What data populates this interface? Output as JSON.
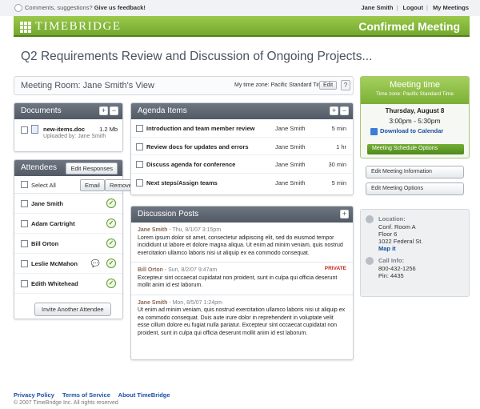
{
  "topbar": {
    "feedback_prefix": "Comments, suggestions?",
    "feedback_link": "Give us feedback!",
    "user": "Jane Smith",
    "logout": "Logout",
    "my_meetings": "My Meetings"
  },
  "header": {
    "logo": "TIMEBRIDGE",
    "status": "Confirmed Meeting"
  },
  "page_title": "Q2 Requirements Review and Discussion of Ongoing Projects...",
  "room": {
    "label": "Meeting Room: Jane Smith's View",
    "timezone": "My time zone: Pacific Standard Time",
    "edit": "Edit",
    "help": "?"
  },
  "documents": {
    "title": "Documents",
    "items": [
      {
        "name": "new-items.doc",
        "size": "1.2 Mb",
        "uploaded": "Uploaded by: Jane Smith"
      }
    ]
  },
  "attendees": {
    "title": "Attendees",
    "edit_responses": "Edit Responses",
    "select_all": "Select All",
    "email": "Email",
    "remove": "Remove",
    "people": [
      "Jane Smith",
      "Adam Cartright",
      "Bill Orton",
      "Leslie McMahon",
      "Edith Whitehead"
    ],
    "invite": "Invite Another Attendee"
  },
  "agenda": {
    "title": "Agenda Items",
    "items": [
      {
        "item": "Introduction and team member review",
        "owner": "Jane Smith",
        "duration": "5 min"
      },
      {
        "item": "Review docs for updates and errors",
        "owner": "Jane Smith",
        "duration": "1 hr"
      },
      {
        "item": "Discuss agenda for conference",
        "owner": "Jane Smith",
        "duration": "30 min"
      },
      {
        "item": "Next steps/Assign teams",
        "owner": "Jane Smith",
        "duration": "5 min"
      }
    ]
  },
  "discussion": {
    "title": "Discussion Posts",
    "posts": [
      {
        "author": "Jane Smith",
        "date": " - Thu, 8/1/07 3:15pm",
        "private": "",
        "body": "Lorem ipsum dolor sit amet, consectetur adipiscing elit, sed do eiusmod tempor incididunt ut labore et dolore magna aliqua. Ut enim ad minim veniam, quis nostrud exercitation ullamco laboris nisi ut aliquip ex ea commodo consequat."
      },
      {
        "author": "Bill Orton",
        "date": " - Sun, 8/2/07 9:47am",
        "private": "PRIVATE",
        "body": "Excepteur sint occaecat cupidatat non proident, sunt in culpa qui officia deserunt mollit anim id est laborum."
      },
      {
        "author": "Jane Smith",
        "date": " - Mon, 8/5/07 1:24pm",
        "private": "",
        "body": "Ut enim ad minim veniam, quis nostrud exercitation ullamco laboris nisi ut aliquip ex ea commodo consequat. Duis aute irure dolor in reprehenderit in voluptate velit esse cillum dolore eu fugiat nulla pariatur. Excepteur sint occaecat cupidatat non proident, sunt in culpa qui officia deserunt mollit anim id est laborum."
      }
    ]
  },
  "meeting_time": {
    "title": "Meeting time",
    "timezone": "Time zone: Pacific Standard Time",
    "day": "Thursday, August 8",
    "times": "3:00pm - 5:30pm",
    "download": "Download to Calendar",
    "schedule_options": "Meeting Schedule Options"
  },
  "actions": {
    "edit_info": "Edit Meeting Information",
    "edit_options": "Edit Meeting Options"
  },
  "location": {
    "label": "Location:",
    "lines": [
      "Conf. Room A",
      "Floor 6",
      "1022 Federal St."
    ],
    "map": "Map it",
    "call_label": "Call Info:",
    "call_lines": [
      "800-432-1256",
      "Pin: 4435"
    ]
  },
  "footer": {
    "privacy": "Privacy Policy",
    "terms": "Terms of Service",
    "about": "About TimeBridge",
    "copyright": "© 2007 TimeBridge Inc. All rights reserved"
  }
}
